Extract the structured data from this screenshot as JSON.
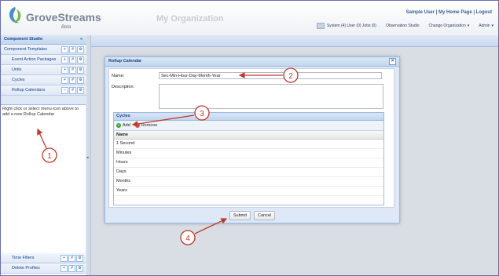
{
  "header": {
    "brand": "GroveStreams",
    "beta": "Beta",
    "organization": "My Organization",
    "user_links": "Sample User | My Home Page | Logout",
    "toolbar": {
      "system": "System (4) User (0) Jobs (0)",
      "observation_studio": "Observation Studio",
      "change_org": "Change Organization",
      "admin": "Admin"
    }
  },
  "left_panel": {
    "title": "Component Studio",
    "collapse_glyph": "«",
    "items": [
      {
        "label": "Component Templates"
      },
      {
        "label": "Event Action Packages"
      },
      {
        "label": "Units"
      },
      {
        "label": "Cycles"
      },
      {
        "label": "Rollup Calendars"
      }
    ],
    "hint": "Right click or select menu icon above to add a new Rollup Calendar",
    "bottom_items": [
      {
        "label": "Time Filters"
      },
      {
        "label": "Delete Profiles"
      }
    ],
    "tool_glyphs": [
      "+",
      "#",
      "⚙"
    ],
    "tool_glyphs_active": [
      "−",
      "#",
      "⚙"
    ]
  },
  "dialog": {
    "title": "Rollup Calendar",
    "close_glyph": "×",
    "name_label": "Name:",
    "name_value": "Sec-Min-Hour-Day-Month-Year",
    "description_label": "Description:",
    "grid": {
      "title": "Cycles",
      "add_label": "Add",
      "remove_label": "Remove",
      "column_header": "Name",
      "rows": [
        "1 Second",
        "Minutes",
        "Hours",
        "Days",
        "Months",
        "Years"
      ]
    },
    "submit_label": "Submit",
    "cancel_label": "Cancel"
  },
  "annotations": [
    "1",
    "2",
    "3",
    "4"
  ],
  "colors": {
    "annotation": "#c0392b",
    "panel_header": "#15428b",
    "accent_border": "#99bbe8"
  }
}
